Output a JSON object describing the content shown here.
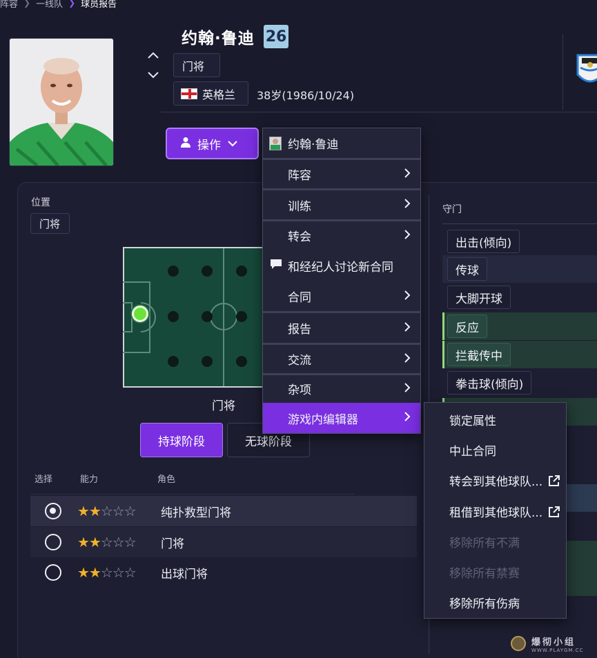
{
  "breadcrumb": {
    "items": [
      "阵容",
      "一线队",
      "球员报告"
    ]
  },
  "player": {
    "name": "约翰·鲁迪",
    "number": "26",
    "position": "门将",
    "nation": "英格兰",
    "age_dob": "38岁(1986/10/24)"
  },
  "action_button": {
    "label": "操作"
  },
  "position_panel": {
    "label": "位置",
    "tag": "门将",
    "pitch_caption": "门将"
  },
  "phase_tabs": {
    "in_possession": "持球阶段",
    "out_possession": "无球阶段"
  },
  "roles": {
    "headers": [
      "选择",
      "能力",
      "角色"
    ],
    "rows": [
      {
        "name": "纯扑救型门将",
        "selected": true,
        "stars": 2
      },
      {
        "name": "门将",
        "selected": false,
        "stars": 2
      },
      {
        "name": "出球门将",
        "selected": false,
        "stars": 2
      }
    ]
  },
  "attributes": {
    "header": "守门",
    "items": [
      "出击(倾向)",
      "传球",
      "大脚开球",
      "反应",
      "拦截传中",
      "拳击球(倾向)"
    ]
  },
  "menu": {
    "items": [
      {
        "label": "约翰·鲁迪",
        "icon": "player-avatar-icon",
        "submenu": false
      },
      {
        "label": "阵容",
        "submenu": true
      },
      {
        "label": "训练",
        "submenu": true
      },
      {
        "label": "转会",
        "submenu": true
      },
      {
        "label": "和经纪人讨论新合同",
        "icon": "chat-icon",
        "submenu": false
      },
      {
        "label": "合同",
        "submenu": true
      },
      {
        "label": "报告",
        "submenu": true
      },
      {
        "label": "交流",
        "submenu": true
      },
      {
        "label": "杂项",
        "submenu": true
      },
      {
        "label": "游戏内编辑器",
        "submenu": true,
        "active": true
      }
    ]
  },
  "submenu": {
    "items": [
      {
        "label": "锁定属性",
        "enabled": true
      },
      {
        "label": "中止合同",
        "enabled": true
      },
      {
        "label": "转会到其他球队...",
        "enabled": true,
        "icon": "external-link-icon"
      },
      {
        "label": "租借到其他球队...",
        "enabled": true,
        "icon": "external-link-icon"
      },
      {
        "label": "移除所有不满",
        "enabled": false
      },
      {
        "label": "移除所有禁赛",
        "enabled": false
      },
      {
        "label": "移除所有伤病",
        "enabled": true
      }
    ]
  },
  "watermark": {
    "text": "爆彻小组",
    "url": "WWW.PLAYGM.CC"
  },
  "colors": {
    "accent": "#7a2fe0",
    "background": "#191a2c",
    "star": "#f2b12a",
    "gk_marker": "#6be23a"
  }
}
